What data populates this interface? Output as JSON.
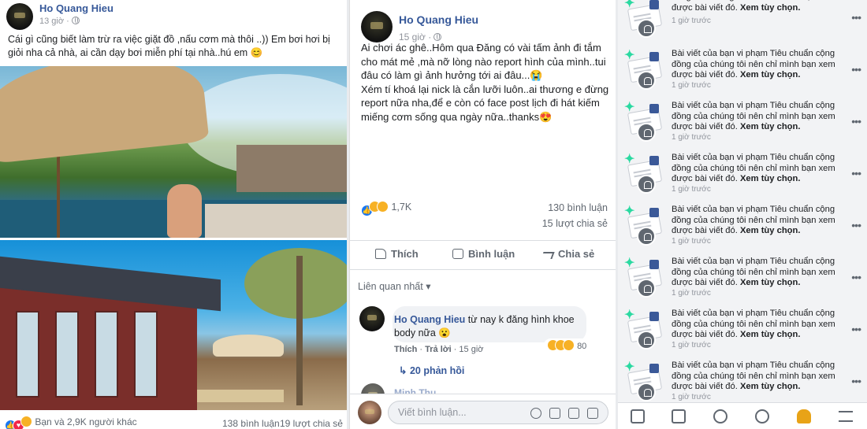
{
  "post1": {
    "author": "Ho Quang Hieu",
    "time": "13 giờ",
    "text": "Cái gì cũng biết làm trừ ra việc giặt đồ ,nấu cơm mà thôi ..)) Em bơi hơi bị giỏi nha cả nhà, ai cần dạy bơi miễn phí tại nhà..hú em 😊",
    "reactions_text": "Bạn và 2,9K người khác",
    "comments": "138 bình luận",
    "shares": "19 lượt chia sẻ"
  },
  "post2": {
    "author": "Ho Quang Hieu",
    "time": "15 giờ",
    "text": "Ai chơi ác ghê..Hôm qua Đăng có vài tấm ảnh đi tắm cho mát mẻ ,mà nỡ lòng nào report hình của mình..tui đâu có làm gì ảnh hưởng tới ai đâu...😭\nXém tí khoá lại nick là cắn lưỡi luôn..ai thương e đừng report nữa nha,để e còn có face post lịch đi hát kiếm miếng cơm sống qua ngày nữa..thanks😍",
    "reactions_count": "1,7K",
    "comments": "130 bình luận",
    "shares": "15 lượt chia sẻ",
    "actions": {
      "like": "Thích",
      "comment": "Bình luận",
      "share": "Chia sẻ"
    },
    "sort_label": "Liên quan nhất",
    "comment": {
      "author": "Ho Quang Hieu",
      "text": "từ nay k đăng hình khoe body nữa 😮",
      "like": "Thích",
      "reply": "Trả lời",
      "time": "15 giờ",
      "reaction_count": "80",
      "replies": "20 phản hồi"
    },
    "next_comment_author": "Minh Thu",
    "reply_placeholder": "Viết bình luận..."
  },
  "notifications": {
    "items": [
      {
        "text": "đồng của chúng tôi nên chỉ mình bạn xem được bài viết đó.",
        "bold": "Xem tùy chọn.",
        "time": "1 giờ trước"
      },
      {
        "text": "Bài viết của bạn vi phạm Tiêu chuẩn cộng đồng của chúng tôi nên chỉ mình bạn xem được bài viết đó.",
        "bold": "Xem tùy chọn.",
        "time": "1 giờ trước"
      },
      {
        "text": "Bài viết của bạn vi phạm Tiêu chuẩn cộng đồng của chúng tôi nên chỉ mình bạn xem được bài viết đó.",
        "bold": "Xem tùy chọn.",
        "time": "1 giờ trước"
      },
      {
        "text": "Bài viết của bạn vi phạm Tiêu chuẩn cộng đồng của chúng tôi nên chỉ mình bạn xem được bài viết đó.",
        "bold": "Xem tùy chọn.",
        "time": "1 giờ trước"
      },
      {
        "text": "Bài viết của bạn vi phạm Tiêu chuẩn cộng đồng của chúng tôi nên chỉ mình bạn xem được bài viết đó.",
        "bold": "Xem tùy chọn.",
        "time": "1 giờ trước"
      },
      {
        "text": "Bài viết của bạn vi phạm Tiêu chuẩn cộng đồng của chúng tôi nên chỉ mình bạn xem được bài viết đó.",
        "bold": "Xem tùy chọn.",
        "time": "1 giờ trước"
      },
      {
        "text": "Bài viết của bạn vi phạm Tiêu chuẩn cộng đồng của chúng tôi nên chỉ mình bạn xem được bài viết đó.",
        "bold": "Xem tùy chọn.",
        "time": "1 giờ trước"
      },
      {
        "text": "Bài viết của bạn vi phạm Tiêu chuẩn cộng đồng của chúng tôi nên chỉ mình bạn xem được bài viết đó.",
        "bold": "Xem tùy chọn.",
        "time": "1 giờ trước"
      }
    ],
    "more_label": "•••"
  },
  "colors": {
    "link": "#365899",
    "meta": "#90949c",
    "notification_bg": "#f2f3f5"
  }
}
